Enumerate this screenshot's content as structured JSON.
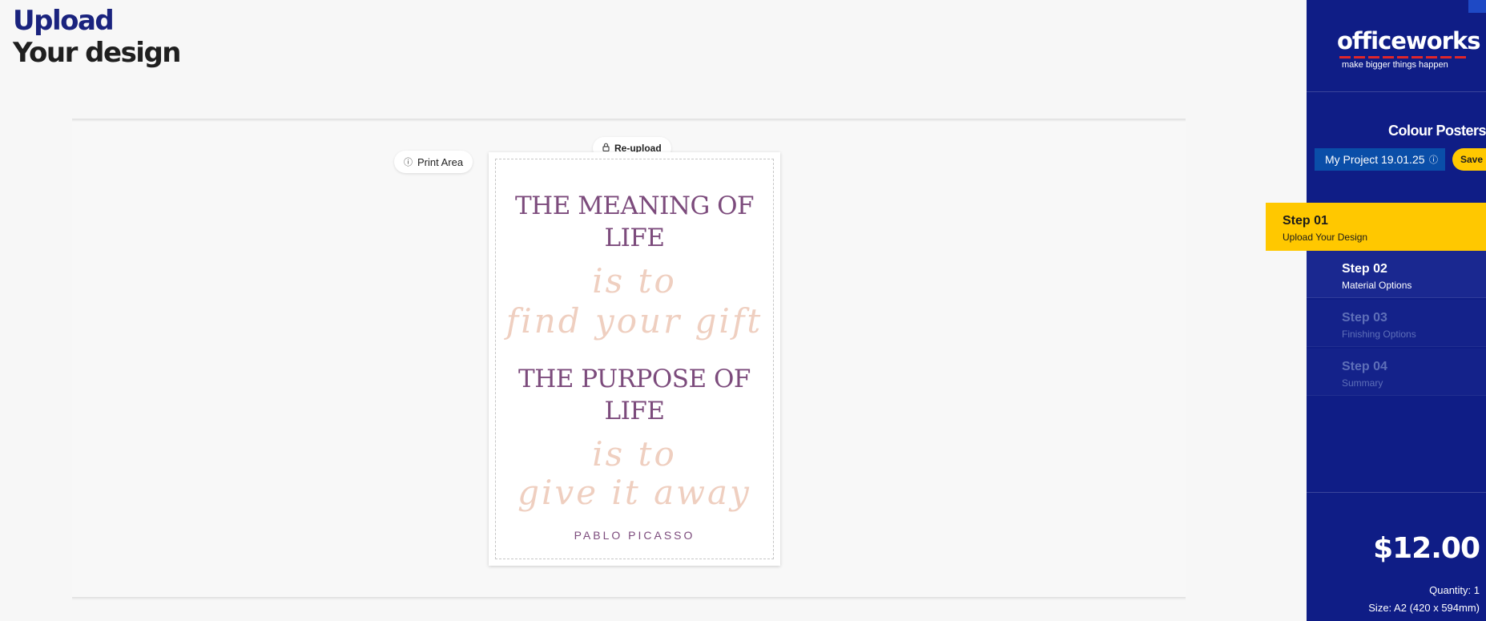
{
  "header": {
    "title_line1": "Upload",
    "title_line2": "Your design"
  },
  "canvas": {
    "print_area_label": "Print Area",
    "print_area_icon": "info-icon",
    "reupload_label": "Re-upload",
    "reupload_icon": "lock-icon"
  },
  "poster": {
    "line1": "THE MEANING OF",
    "line2": "LIFE",
    "script1a": "is to",
    "script1b": "find your gift",
    "line3": "THE PURPOSE OF",
    "line4": "LIFE",
    "script2a": "is to",
    "script2b": "give it away",
    "author": "PABLO PICASSO",
    "colors": {
      "serif": "#7c4b7c",
      "script": "#efcfc0"
    }
  },
  "sidebar": {
    "logo_text": "officeworks",
    "logo_tagline": "make bigger things happen",
    "product_name": "Colour Posters",
    "project_name": "My Project 19.01.25",
    "save_label": "Save",
    "steps": [
      {
        "number": "Step 01",
        "label": "Upload Your Design",
        "state": "active"
      },
      {
        "number": "Step 02",
        "label": "Material Options",
        "state": "next"
      },
      {
        "number": "Step 03",
        "label": "Finishing Options",
        "state": "disabled"
      },
      {
        "number": "Step 04",
        "label": "Summary",
        "state": "disabled"
      }
    ],
    "price": "$12.00",
    "quantity": "Quantity: 1",
    "size": "Size: A2 (420 x 594mm)",
    "colors": {
      "background": "#0f1d86",
      "accent": "#ffc800",
      "logo_dash": "#e0262a"
    }
  }
}
